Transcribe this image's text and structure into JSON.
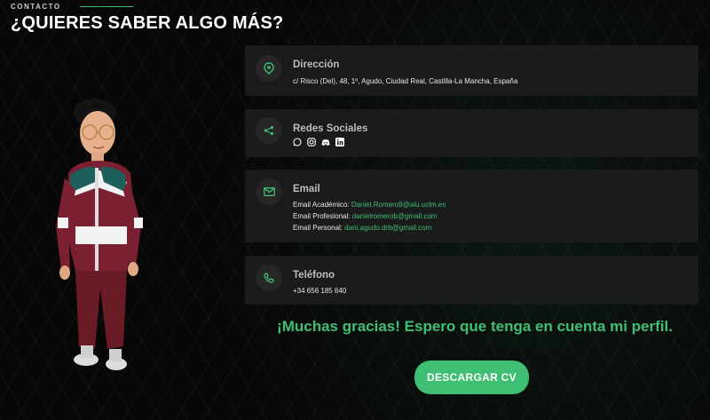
{
  "section": {
    "eyebrow": "CONTACTO",
    "heading": "¿QUIERES SABER ALGO MÁS?"
  },
  "address": {
    "title": "Dirección",
    "text": "c/ Risco (Del), 48, 1º, Agudo, Ciudad Real, Castilla-La Mancha, España",
    "icon": "map-pin-icon"
  },
  "social": {
    "title": "Redes Sociales",
    "icon": "share-icon",
    "networks": [
      "whatsapp-icon",
      "instagram-icon",
      "discord-icon",
      "linkedin-icon"
    ]
  },
  "email": {
    "title": "Email",
    "icon": "mail-icon",
    "entries": [
      {
        "label": "Email Académico:",
        "value": "Daniel.Romero9@alu.uclm.es"
      },
      {
        "label": "Email Profesional:",
        "value": "danielromerob@gmail.com"
      },
      {
        "label": "Email Personal:",
        "value": "dani.agudo.drb@gmail.com"
      }
    ]
  },
  "phone": {
    "title": "Teléfono",
    "text": "+34 656 185 640",
    "icon": "phone-icon"
  },
  "closing": {
    "thanks": "¡Muchas gracias! Espero que tenga en cuenta mi perfil.",
    "button": "DESCARGAR CV"
  },
  "colors": {
    "accent": "#3fbf73",
    "card": "#1c1c1c",
    "background": "#0a0a0a"
  }
}
